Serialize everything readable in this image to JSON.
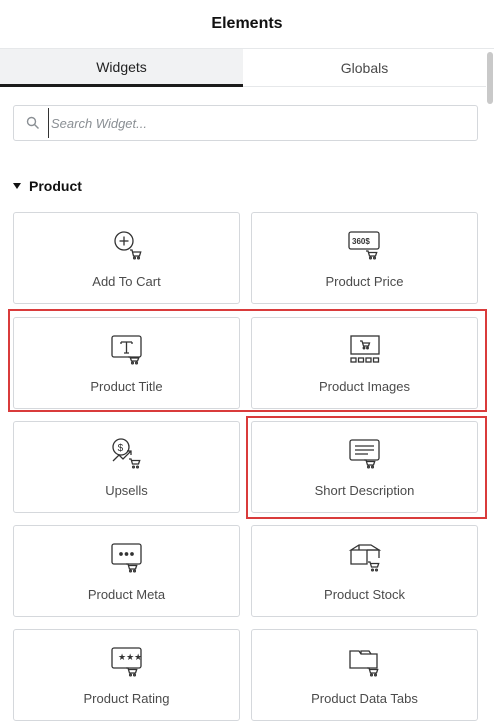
{
  "panel": {
    "title": "Elements"
  },
  "tabs": [
    {
      "label": "Widgets",
      "active": true
    },
    {
      "label": "Globals",
      "active": false
    }
  ],
  "search": {
    "placeholder": "Search Widget..."
  },
  "category": {
    "label": "Product",
    "expanded": true
  },
  "widgets": [
    {
      "label": "Add To Cart",
      "icon": "add-to-cart-icon"
    },
    {
      "label": "Product Price",
      "icon": "product-price-icon"
    },
    {
      "label": "Product Title",
      "icon": "product-title-icon"
    },
    {
      "label": "Product Images",
      "icon": "product-images-icon"
    },
    {
      "label": "Upsells",
      "icon": "upsells-icon"
    },
    {
      "label": "Short Description",
      "icon": "short-description-icon"
    },
    {
      "label": "Product Meta",
      "icon": "product-meta-icon"
    },
    {
      "label": "Product Stock",
      "icon": "product-stock-icon"
    },
    {
      "label": "Product Rating",
      "icon": "product-rating-icon"
    },
    {
      "label": "Product Data Tabs",
      "icon": "product-data-tabs-icon"
    }
  ],
  "colors": {
    "highlight": "#d93b3b",
    "icon_stroke": "#333333",
    "border": "#d5d8dc"
  }
}
